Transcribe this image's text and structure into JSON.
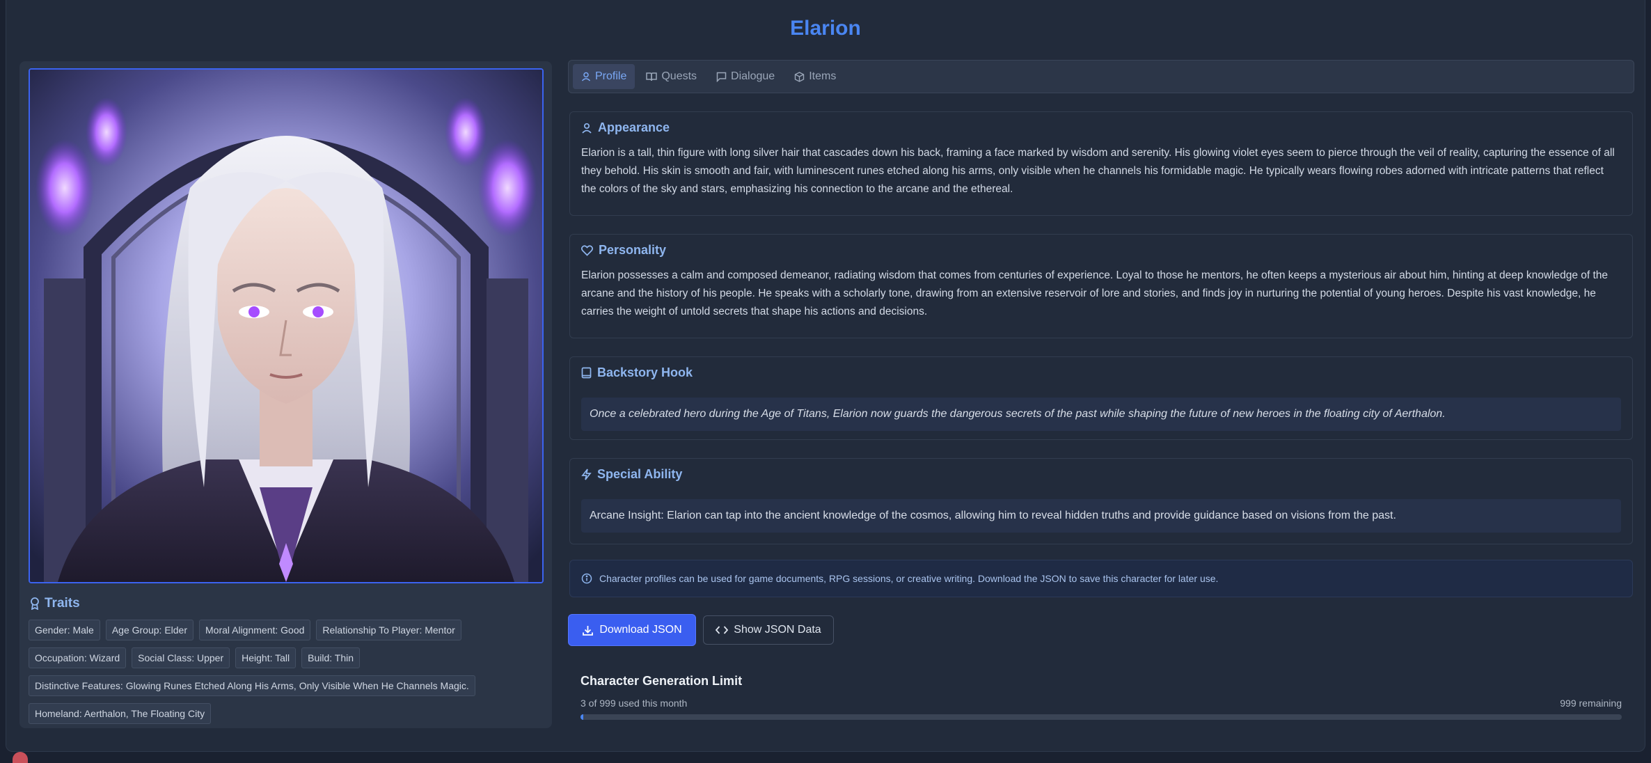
{
  "character": {
    "name": "Elarion"
  },
  "tabs": [
    {
      "label": "Profile",
      "icon": "user-icon",
      "active": true
    },
    {
      "label": "Quests",
      "icon": "book-open-icon",
      "active": false
    },
    {
      "label": "Dialogue",
      "icon": "message-icon",
      "active": false
    },
    {
      "label": "Items",
      "icon": "package-icon",
      "active": false
    }
  ],
  "sections": {
    "appearance": {
      "title": "Appearance",
      "text": "Elarion is a tall, thin figure with long silver hair that cascades down his back, framing a face marked by wisdom and serenity. His glowing violet eyes seem to pierce through the veil of reality, capturing the essence of all they behold. His skin is smooth and fair, with luminescent runes etched along his arms, only visible when he channels his formidable magic. He typically wears flowing robes adorned with intricate patterns that reflect the colors of the sky and stars, emphasizing his connection to the arcane and the ethereal."
    },
    "personality": {
      "title": "Personality",
      "text": "Elarion possesses a calm and composed demeanor, radiating wisdom that comes from centuries of experience. Loyal to those he mentors, he often keeps a mysterious air about him, hinting at deep knowledge of the arcane and the history of his people. He speaks with a scholarly tone, drawing from an extensive reservoir of lore and stories, and finds joy in nurturing the potential of young heroes. Despite his vast knowledge, he carries the weight of untold secrets that shape his actions and decisions."
    },
    "backstory": {
      "title": "Backstory Hook",
      "text": "Once a celebrated hero during the Age of Titans, Elarion now guards the dangerous secrets of the past while shaping the future of new heroes in the floating city of Aerthalon."
    },
    "ability": {
      "title": "Special Ability",
      "text": "Arcane Insight: Elarion can tap into the ancient knowledge of the cosmos, allowing him to reveal hidden truths and provide guidance based on visions from the past."
    }
  },
  "traits": {
    "title": "Traits",
    "rows": [
      [
        "Gender: Male",
        "Age Group: Elder",
        "Moral Alignment: Good",
        "Relationship To Player: Mentor"
      ],
      [
        "Occupation: Wizard",
        "Social Class: Upper",
        "Height: Tall",
        "Build: Thin"
      ],
      [
        "Distinctive Features: Glowing Runes Etched Along His Arms, Only Visible When He Channels Magic."
      ],
      [
        "Homeland: Aerthalon, The Floating City"
      ]
    ]
  },
  "info_text": "Character profiles can be used for game documents, RPG sessions, or creative writing. Download the JSON to save this character for later use.",
  "buttons": {
    "download": "Download JSON",
    "show": "Show JSON Data"
  },
  "limit": {
    "title": "Character Generation Limit",
    "used_text": "3 of 999 used this month",
    "remaining_text": "999 remaining",
    "used": 3,
    "total": 999
  },
  "colors": {
    "accent": "#4a86f2",
    "button": "#3a5ef0",
    "background": "#222b3b"
  }
}
